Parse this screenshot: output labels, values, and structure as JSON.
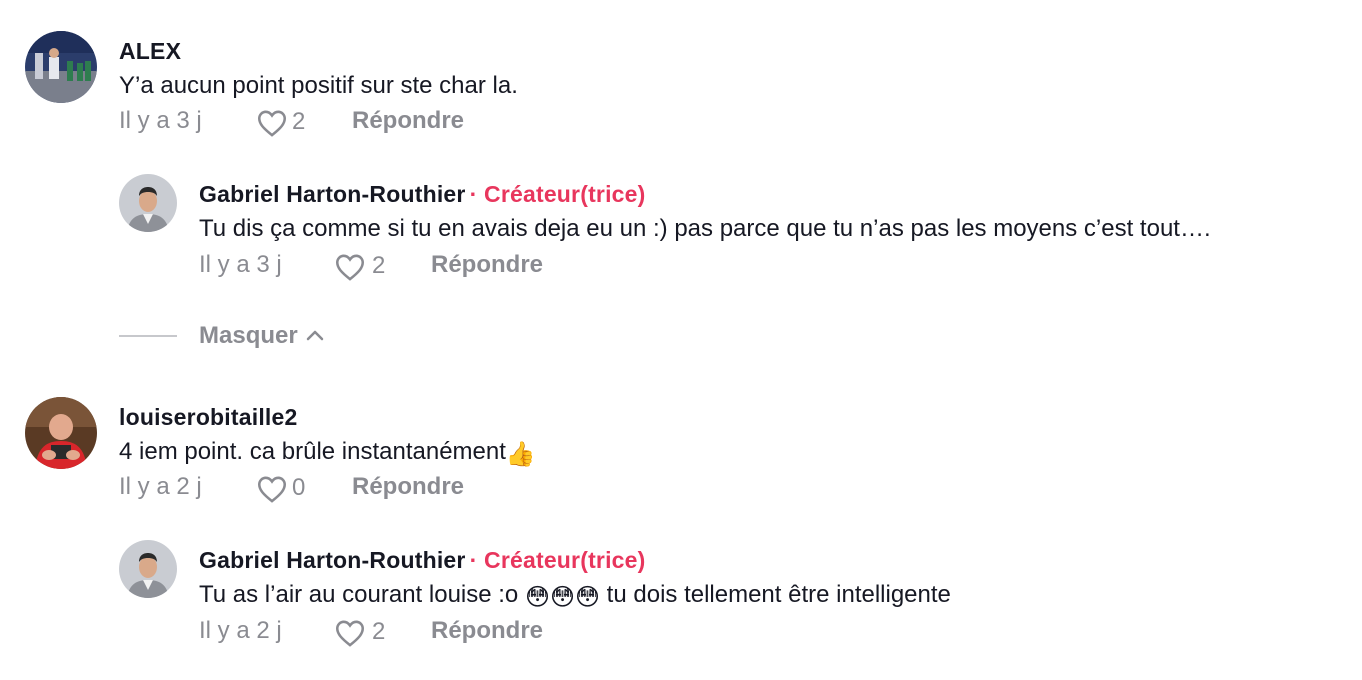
{
  "comments": [
    {
      "username": "ALEX",
      "text": "Y’a aucun point positif sur ste char la.",
      "time": "Il y a 3 j",
      "likes": "2",
      "reply_label": "Répondre",
      "replies": [
        {
          "username": "Gabriel Harton-Routhier",
          "badge": "· Créateur(trice)",
          "text": "Tu dis ça comme si tu en avais deja eu un :) pas parce que tu n’as pas les moyens c’est tout….",
          "time": "Il y a 3 j",
          "likes": "2",
          "reply_label": "Répondre"
        }
      ],
      "collapse_label": "Masquer"
    },
    {
      "username": "louiserobitaille2",
      "text": "4 iem point. ca brûle instantanément",
      "text_emoji": "👍",
      "time": "Il y a 2 j",
      "likes": "0",
      "reply_label": "Répondre",
      "replies": [
        {
          "username": "Gabriel Harton-Routhier",
          "badge": "· Créateur(trice)",
          "text_before": "Tu as l’air au courant louise :o ",
          "text_emoji": "😳😳😳",
          "text_after": " tu dois tellement être intelligente",
          "time": "Il y a 2 j",
          "likes": "2",
          "reply_label": "Répondre"
        }
      ]
    }
  ],
  "colors": {
    "creator_badge": "#e8365d",
    "meta_gray": "#8a8b91",
    "text": "#161823"
  },
  "icons": {
    "like": "heart-outline-icon",
    "collapse": "chevron-up-icon"
  }
}
